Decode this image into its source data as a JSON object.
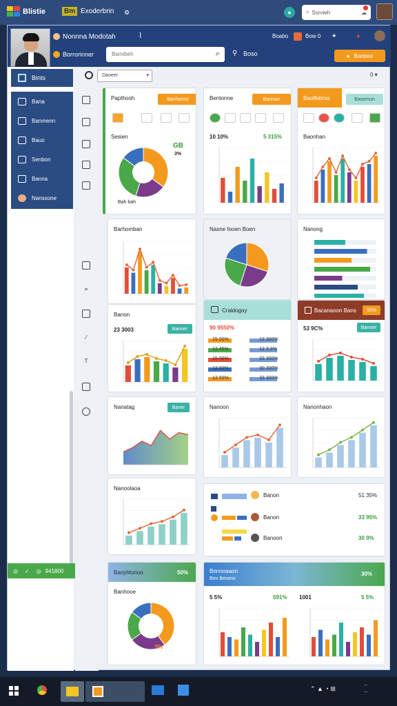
{
  "topbar": {
    "brand": "Blistie",
    "brand_tag": "Bm",
    "brand_sub": "Exoderbrin",
    "search_text": "Ssrvieh"
  },
  "header": {
    "user_name": "Nonnna Modotah",
    "user_role": "Borrorinner",
    "label_right_1": "Boabo",
    "label_right_2": "Bow 0",
    "search_placeholder": "Bamibeh",
    "user_icon_label": "Boso",
    "orange_button": "Banbee"
  },
  "sidebar": {
    "active": "Bints",
    "items": [
      "Bana",
      "Banmenn",
      "Bauo",
      "Senbon",
      "Banna",
      "Nanssone"
    ],
    "bottom_value": "941800"
  },
  "filter": {
    "select_value": "Daoeer",
    "right_label": "0 ▾"
  },
  "cards": {
    "c1": {
      "title": "Papthooh",
      "button": "Banhenns",
      "num1": "GB",
      "num2": "3%",
      "footer": "Bah bah"
    },
    "c2": {
      "title": "Bentonne",
      "button": "Bannarr",
      "num1": "10 10%",
      "num2": "5 315%"
    },
    "c3": {
      "title": "Baoffobrsa",
      "button": "Basemon",
      "subtitle": "Baonhan"
    },
    "c4": {
      "title": "Barhomban"
    },
    "c5": {
      "title": "Nasne fooen Boen"
    },
    "c6": {
      "title": "Nanong"
    },
    "c7": {
      "title": "Banon",
      "num1": "23 3003",
      "button": "Banoer"
    },
    "c8": {
      "title": "Craldogoy",
      "num1": "90 9550%",
      "rows": [
        {
          "a": "15 00%",
          "b": "13 300%"
        },
        {
          "a": "13 45%",
          "b": "12 3:3%"
        },
        {
          "a": "15 00%",
          "b": "33 300%"
        },
        {
          "a": "13 00%",
          "b": "30 300%"
        },
        {
          "a": "13 50%",
          "b": "33 300%"
        }
      ]
    },
    "c9": {
      "title": "Bacanaoon Bans",
      "badge": "55%",
      "num1": "53 9C%",
      "button": "Banoer"
    },
    "c10": {
      "title": "Nanatag",
      "button": "Baner"
    },
    "c11": {
      "title": "Nanoon"
    },
    "c12": {
      "title": "Nanonhaon"
    },
    "c13": {
      "title": "Nanoolaoa"
    },
    "c14": {
      "row1": "Banon",
      "row1_val": "51 35%",
      "row2": "Banon",
      "row2_val": "33 95%",
      "row3": "Banoon",
      "row3_val": "30 9%"
    },
    "c15": {
      "title": "Baoyhtonoo",
      "badge": "50%",
      "subtitle": "Banhooe",
      "num1": "5%"
    },
    "c16": {
      "title": "Bnnnoaaon",
      "subtitle": "Ben Besens",
      "badge": "30%",
      "num1": "5 5%",
      "num2": "591%",
      "num3": "1001",
      "num4": "5 5%"
    }
  },
  "colors": {
    "accent_orange": "#f39a1e",
    "accent_green": "#4aa84a",
    "accent_navy": "#23417a",
    "accent_teal": "#3bb2a6"
  },
  "chart_data": [
    {
      "type": "pie",
      "values": [
        35,
        20,
        30,
        15
      ]
    },
    {
      "type": "bar",
      "values": [
        45,
        20,
        65,
        40,
        80,
        30,
        55,
        25,
        35
      ]
    },
    {
      "type": "bar",
      "values": [
        40,
        60,
        75,
        50,
        80,
        55,
        40,
        65,
        70,
        85
      ]
    },
    {
      "type": "bar",
      "values": [
        50,
        40,
        80,
        45,
        55,
        20,
        15,
        30,
        10,
        12
      ]
    },
    {
      "type": "pie",
      "values": [
        30,
        25,
        25,
        20
      ]
    },
    {
      "type": "bar",
      "values": [
        50,
        85,
        60,
        90,
        45,
        70,
        80
      ]
    },
    {
      "type": "line",
      "values": [
        30,
        35,
        55,
        45,
        60,
        50,
        70,
        80
      ]
    },
    {
      "type": "bar",
      "values": [
        40,
        55,
        60,
        50,
        45,
        35
      ]
    },
    {
      "type": "area",
      "values": [
        30,
        40,
        55,
        45,
        80,
        60,
        75,
        70
      ]
    },
    {
      "type": "line",
      "values": [
        25,
        40,
        55,
        60,
        50,
        80
      ]
    },
    {
      "type": "line",
      "values": [
        20,
        30,
        45,
        55,
        70,
        85
      ]
    },
    {
      "type": "line",
      "values": [
        20,
        30,
        40,
        45,
        55,
        70
      ]
    },
    {
      "type": "pie",
      "values": [
        40,
        25,
        20,
        15
      ]
    },
    {
      "type": "bar",
      "values": [
        50,
        40,
        35,
        60,
        45,
        30,
        55,
        70,
        40,
        80
      ]
    },
    {
      "type": "bar",
      "values": [
        40,
        55,
        35,
        45,
        70,
        30,
        50,
        60,
        45,
        75
      ]
    }
  ]
}
